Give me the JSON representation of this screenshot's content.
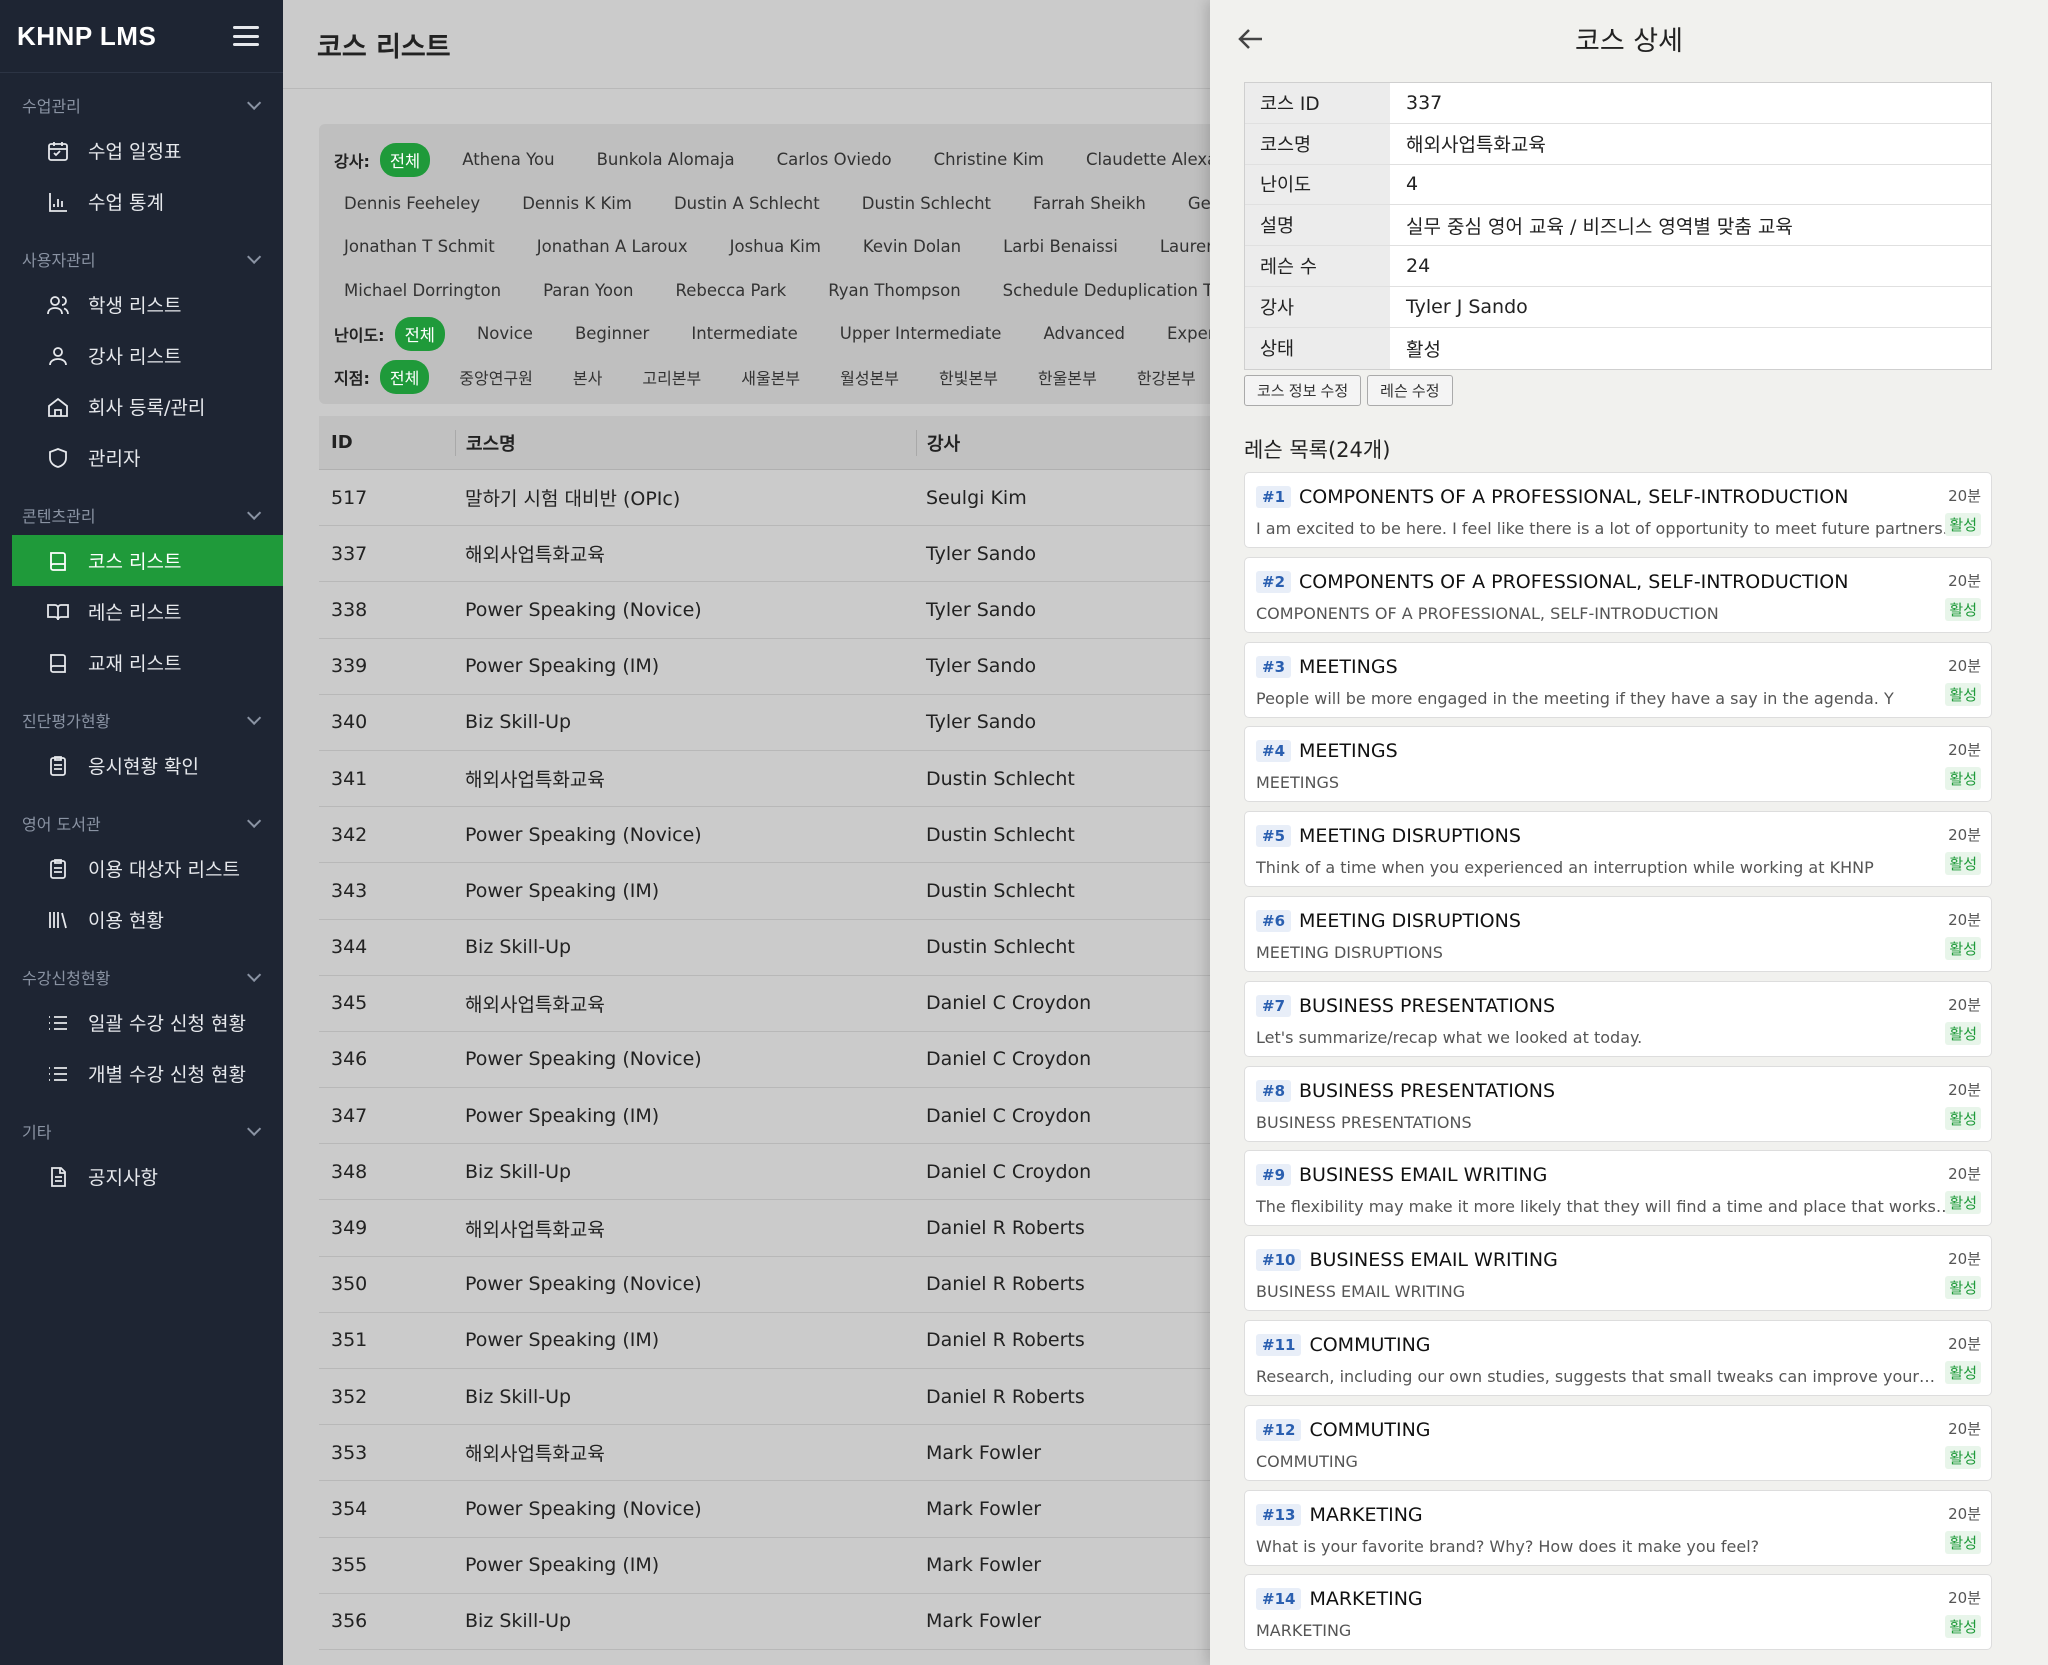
{
  "app": {
    "brand": "KHNP LMS"
  },
  "sidebar": {
    "groups": [
      {
        "title": "수업관리",
        "items": [
          {
            "label": "수업 일정표",
            "icon": "calendar-icon"
          },
          {
            "label": "수업 통계",
            "icon": "chart-icon"
          }
        ]
      },
      {
        "title": "사용자관리",
        "items": [
          {
            "label": "학생 리스트",
            "icon": "users-icon"
          },
          {
            "label": "강사 리스트",
            "icon": "user-icon"
          },
          {
            "label": "회사 등록/관리",
            "icon": "home-icon"
          },
          {
            "label": "관리자",
            "icon": "shield-icon"
          }
        ]
      },
      {
        "title": "콘텐츠관리",
        "items": [
          {
            "label": "코스 리스트",
            "icon": "book-icon",
            "active": true
          },
          {
            "label": "레슨 리스트",
            "icon": "open-book-icon"
          },
          {
            "label": "교재 리스트",
            "icon": "book-icon"
          }
        ]
      },
      {
        "title": "진단평가현황",
        "items": [
          {
            "label": "응시현황 확인",
            "icon": "clipboard-icon"
          }
        ]
      },
      {
        "title": "영어 도서관",
        "items": [
          {
            "label": "이용 대상자 리스트",
            "icon": "clipboard-icon"
          },
          {
            "label": "이용 현황",
            "icon": "library-icon"
          }
        ]
      },
      {
        "title": "수강신청현황",
        "items": [
          {
            "label": "일괄 수강 신청 현황",
            "icon": "list-icon"
          },
          {
            "label": "개별 수강 신청 현황",
            "icon": "list-icon"
          }
        ]
      },
      {
        "title": "기타",
        "items": [
          {
            "label": "공지사항",
            "icon": "document-icon"
          }
        ]
      }
    ]
  },
  "main": {
    "title": "코스 리스트",
    "filters": {
      "teacher_label": "강사:",
      "teacher_rows": [
        [
          "전체",
          "Athena You",
          "Bunkola Alomaja",
          "Carlos Oviedo",
          "Christine Kim",
          "Claudette Alexander"
        ],
        [
          "Dennis Feeheley",
          "Dennis K Kim",
          "Dustin A Schlecht",
          "Dustin Schlecht",
          "Farrah Sheikh",
          "George"
        ],
        [
          "Jonathan T Schmit",
          "Jonathan A Laroux",
          "Joshua Kim",
          "Kevin Dolan",
          "Larbi Benaissi",
          "Lauren"
        ],
        [
          "Michael Dorrington",
          "Paran Yoon",
          "Rebecca Park",
          "Ryan Thompson",
          "Schedule Deduplication Test"
        ]
      ],
      "level_label": "난이도:",
      "levels": [
        "전체",
        "Novice",
        "Beginner",
        "Intermediate",
        "Upper Intermediate",
        "Advanced",
        "Expert"
      ],
      "branch_label": "지점:",
      "branches": [
        "전체",
        "중앙연구원",
        "본사",
        "고리본부",
        "새울본부",
        "월성본부",
        "한빛본부",
        "한울본부",
        "한강본부"
      ]
    },
    "table": {
      "headers": [
        "ID",
        "코스명",
        "강사"
      ],
      "rows": [
        [
          "517",
          "말하기 시험 대비반 (OPIc)",
          "Seulgi Kim"
        ],
        [
          "337",
          "해외사업특화교육",
          "Tyler Sando"
        ],
        [
          "338",
          "Power Speaking (Novice)",
          "Tyler Sando"
        ],
        [
          "339",
          "Power Speaking (IM)",
          "Tyler Sando"
        ],
        [
          "340",
          "Biz Skill-Up",
          "Tyler Sando"
        ],
        [
          "341",
          "해외사업특화교육",
          "Dustin Schlecht"
        ],
        [
          "342",
          "Power Speaking (Novice)",
          "Dustin Schlecht"
        ],
        [
          "343",
          "Power Speaking (IM)",
          "Dustin Schlecht"
        ],
        [
          "344",
          "Biz Skill-Up",
          "Dustin Schlecht"
        ],
        [
          "345",
          "해외사업특화교육",
          "Daniel C Croydon"
        ],
        [
          "346",
          "Power Speaking (Novice)",
          "Daniel C Croydon"
        ],
        [
          "347",
          "Power Speaking (IM)",
          "Daniel C Croydon"
        ],
        [
          "348",
          "Biz Skill-Up",
          "Daniel C Croydon"
        ],
        [
          "349",
          "해외사업특화교육",
          "Daniel R Roberts"
        ],
        [
          "350",
          "Power Speaking (Novice)",
          "Daniel R Roberts"
        ],
        [
          "351",
          "Power Speaking (IM)",
          "Daniel R Roberts"
        ],
        [
          "352",
          "Biz Skill-Up",
          "Daniel R Roberts"
        ],
        [
          "353",
          "해외사업특화교육",
          "Mark Fowler"
        ],
        [
          "354",
          "Power Speaking (Novice)",
          "Mark Fowler"
        ],
        [
          "355",
          "Power Speaking (IM)",
          "Mark Fowler"
        ],
        [
          "356",
          "Biz Skill-Up",
          "Mark Fowler"
        ]
      ]
    }
  },
  "panel": {
    "title": "코스 상세",
    "info": [
      [
        "코스 ID",
        "337"
      ],
      [
        "코스명",
        "해외사업특화교육"
      ],
      [
        "난이도",
        "4"
      ],
      [
        "설명",
        "실무 중심 영어 교육 / 비즈니스 영역별 맞춤 교육"
      ],
      [
        "레슨 수",
        "24"
      ],
      [
        "강사",
        "Tyler J Sando"
      ],
      [
        "상태",
        "활성"
      ]
    ],
    "buttons": {
      "edit_course": "코스 정보 수정",
      "edit_lessons": "레슨 수정"
    },
    "lessons_title": "레슨 목록(24개)",
    "lessons": [
      {
        "num": "#1",
        "name": "COMPONENTS OF A PROFESSIONAL, SELF-INTRODUCTION",
        "desc": "I am excited to be here. I feel like there is a lot of opportunity to meet future partners.",
        "duration": "20분",
        "status": "활성"
      },
      {
        "num": "#2",
        "name": "COMPONENTS OF A PROFESSIONAL, SELF-INTRODUCTION",
        "desc": "COMPONENTS OF A PROFESSIONAL, SELF-INTRODUCTION",
        "duration": "20분",
        "status": "활성"
      },
      {
        "num": "#3",
        "name": "MEETINGS",
        "desc": "People will be more engaged in the meeting if they have a say in the agenda. Y",
        "duration": "20분",
        "status": "활성"
      },
      {
        "num": "#4",
        "name": "MEETINGS",
        "desc": "MEETINGS",
        "duration": "20분",
        "status": "활성"
      },
      {
        "num": "#5",
        "name": "MEETING DISRUPTIONS",
        "desc": "Think of a time when you experienced an interruption while working at KHNP",
        "duration": "20분",
        "status": "활성"
      },
      {
        "num": "#6",
        "name": "MEETING DISRUPTIONS",
        "desc": "MEETING DISRUPTIONS",
        "duration": "20분",
        "status": "활성"
      },
      {
        "num": "#7",
        "name": "BUSINESS PRESENTATIONS",
        "desc": "Let's summarize/recap what we looked at today.",
        "duration": "20분",
        "status": "활성"
      },
      {
        "num": "#8",
        "name": "BUSINESS PRESENTATIONS",
        "desc": "BUSINESS PRESENTATIONS",
        "duration": "20분",
        "status": "활성"
      },
      {
        "num": "#9",
        "name": "BUSINESS EMAIL WRITING",
        "desc": "The flexibility may make it more likely that they will find a time and place that works for bot…",
        "duration": "20분",
        "status": "활성"
      },
      {
        "num": "#10",
        "name": "BUSINESS EMAIL WRITING",
        "desc": "BUSINESS EMAIL WRITING",
        "duration": "20분",
        "status": "활성"
      },
      {
        "num": "#11",
        "name": "COMMUTING",
        "desc": "Research, including our own studies, suggests that small tweaks can improve your…",
        "duration": "20분",
        "status": "활성"
      },
      {
        "num": "#12",
        "name": "COMMUTING",
        "desc": "COMMUTING",
        "duration": "20분",
        "status": "활성"
      },
      {
        "num": "#13",
        "name": "MARKETING",
        "desc": "What is your favorite brand? Why? How does it make you feel?",
        "duration": "20분",
        "status": "활성"
      },
      {
        "num": "#14",
        "name": "MARKETING",
        "desc": "MARKETING",
        "duration": "20분",
        "status": "활성"
      }
    ]
  },
  "colors": {
    "sidebar_bg": "#1e2533",
    "accent_green": "#1f9a3a",
    "badge_blue": "#2a5fb0"
  }
}
